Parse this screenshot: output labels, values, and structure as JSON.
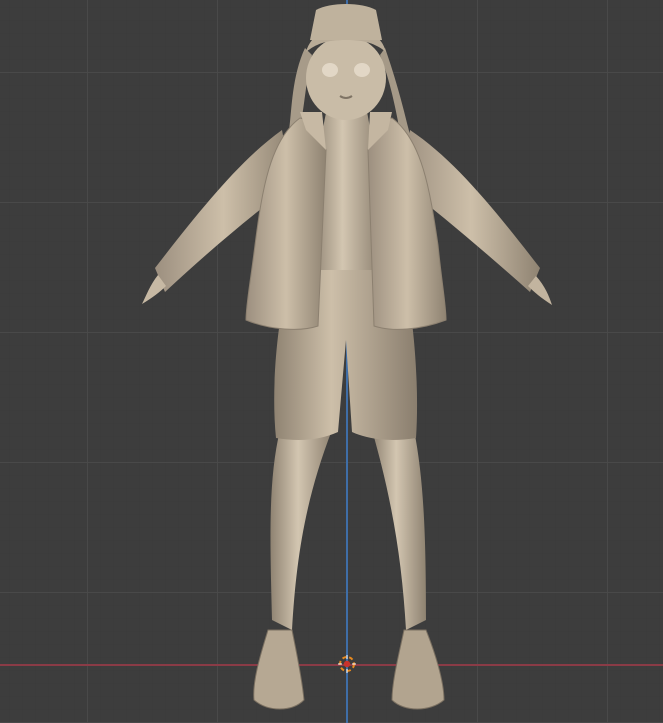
{
  "viewport": {
    "background": "#3d3d3d",
    "grid_major": "#4a4a4a",
    "grid_minor": "#3a3a3a",
    "x_axis_color": "#8a3b46",
    "z_axis_color": "#3f6ea7"
  },
  "model": {
    "shade_base": "#b8a996",
    "shade_light": "#d7cab5",
    "shade_dark": "#7f7465"
  },
  "cursor": {
    "outer": "#e88a1f",
    "inner": "#c9332c"
  }
}
